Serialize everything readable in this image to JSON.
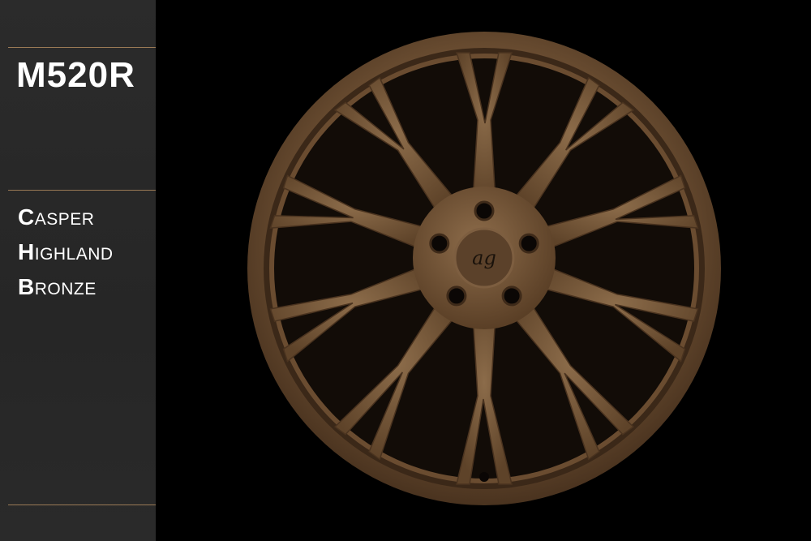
{
  "model": "M520R",
  "color_lines": [
    {
      "initial": "C",
      "rest": "asper"
    },
    {
      "initial": "H",
      "rest": "ighland"
    },
    {
      "initial": "B",
      "rest": "ronze"
    }
  ],
  "logo_text": "ag",
  "colors": {
    "sidebar_bg": "#282828",
    "accent_rule": "#9a7a55",
    "bronze": "#7a5a3c",
    "background": "#000000"
  }
}
